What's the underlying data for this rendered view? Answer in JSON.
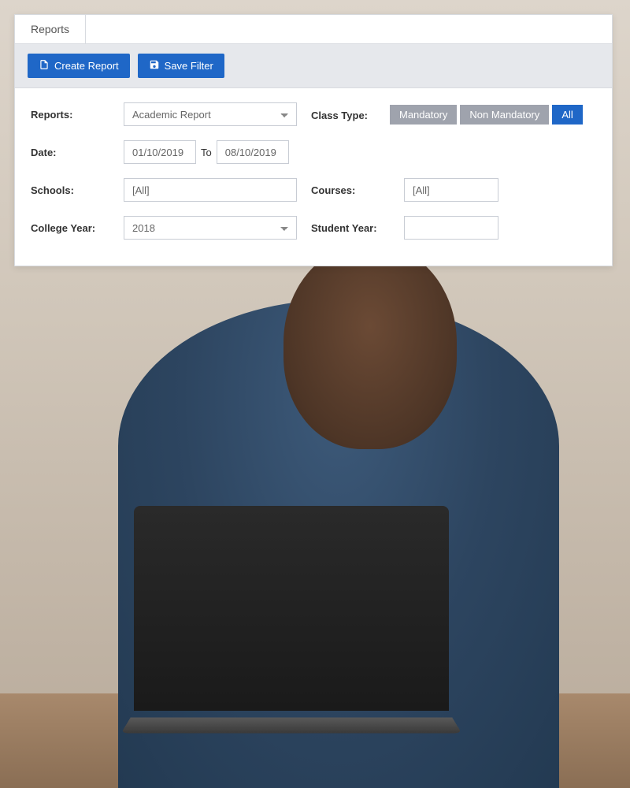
{
  "tab": {
    "label": "Reports"
  },
  "toolbar": {
    "create_report_label": "Create Report",
    "save_filter_label": "Save Filter"
  },
  "form": {
    "reports_label": "Reports:",
    "reports_value": "Academic Report",
    "date_label": "Date:",
    "date_from": "01/10/2019",
    "date_sep": "To",
    "date_to": "08/10/2019",
    "schools_label": "Schools:",
    "schools_value": "[All]",
    "college_year_label": "College Year:",
    "college_year_value": "2018",
    "class_type_label": "Class Type:",
    "class_type_options": {
      "mandatory": "Mandatory",
      "non_mandatory": "Non Mandatory",
      "all": "All"
    },
    "courses_label": "Courses:",
    "courses_value": "[All]",
    "student_year_label": "Student Year:",
    "student_year_value": ""
  }
}
